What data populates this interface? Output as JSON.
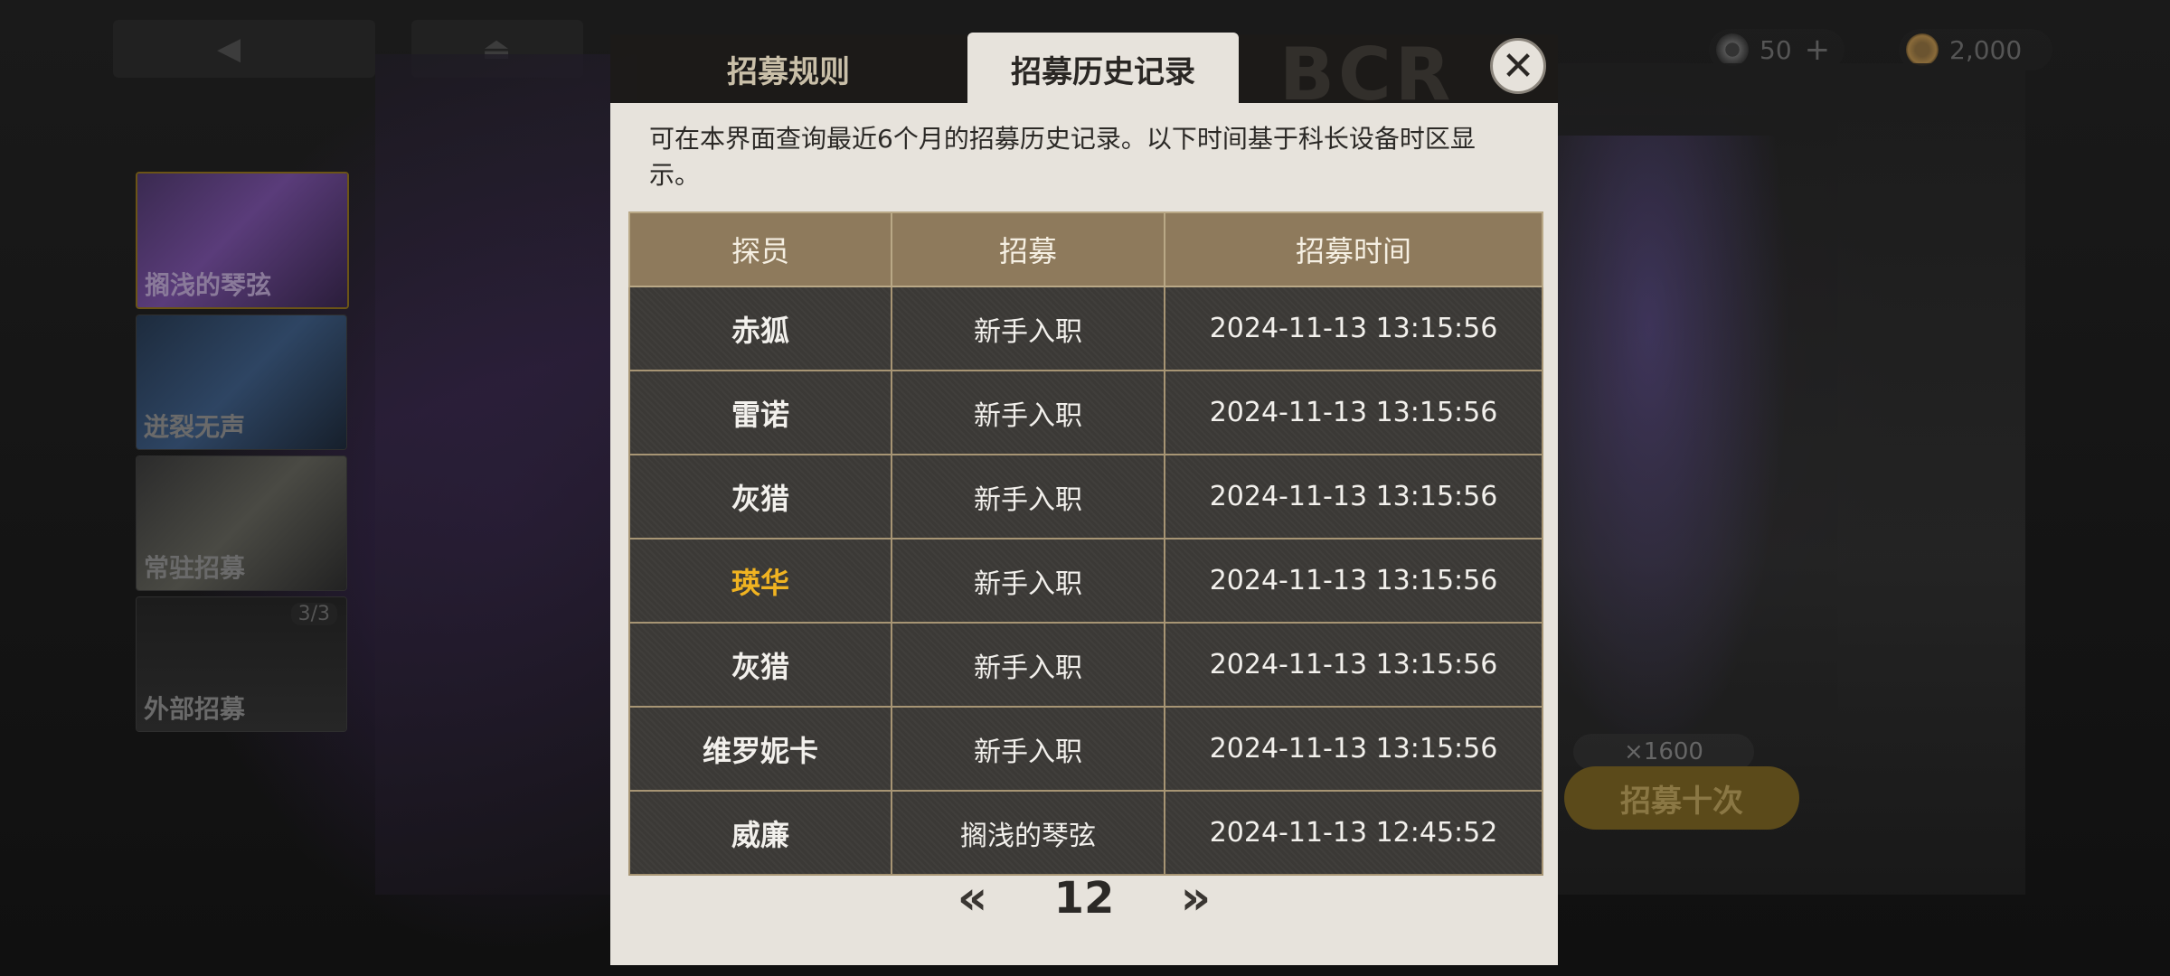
{
  "top_bar": {
    "back_glyph": "◀",
    "home_glyph": "⏏",
    "currency_1": {
      "icon": "disc-icon",
      "value": "50",
      "plus": "+"
    },
    "currency_2": {
      "icon": "gold-coin-icon",
      "value": "2,000"
    }
  },
  "left_tabs": [
    {
      "label": "搁浅的琴弦",
      "active": true,
      "badge": ""
    },
    {
      "label": "迸裂无声",
      "active": false,
      "badge": ""
    },
    {
      "label": "常驻招募",
      "active": false,
      "badge": ""
    },
    {
      "label": "外部招募",
      "active": false,
      "badge": "3/3"
    }
  ],
  "banner": {
    "recruit_ten_label": "招募十次",
    "cost": "×1600"
  },
  "modal": {
    "tabs": [
      {
        "label": "招募规则",
        "active": false
      },
      {
        "label": "招募历史记录",
        "active": true
      }
    ],
    "watermark": "BCR",
    "close_glyph": "✕",
    "description": "可在本界面查询最近6个月的招募历史记录。以下时间基于科长设备时区显示。",
    "table": {
      "headers": [
        "探员",
        "招募",
        "招募时间"
      ],
      "rows": [
        {
          "agent": "赤狐",
          "pool": "新手入职",
          "time": "2024-11-13 13:15:56",
          "highlight": false
        },
        {
          "agent": "雷诺",
          "pool": "新手入职",
          "time": "2024-11-13 13:15:56",
          "highlight": false
        },
        {
          "agent": "灰猎",
          "pool": "新手入职",
          "time": "2024-11-13 13:15:56",
          "highlight": false
        },
        {
          "agent": "瑛华",
          "pool": "新手入职",
          "time": "2024-11-13 13:15:56",
          "highlight": true
        },
        {
          "agent": "灰猎",
          "pool": "新手入职",
          "time": "2024-11-13 13:15:56",
          "highlight": false
        },
        {
          "agent": "维罗妮卡",
          "pool": "新手入职",
          "time": "2024-11-13 13:15:56",
          "highlight": false
        },
        {
          "agent": "威廉",
          "pool": "搁浅的琴弦",
          "time": "2024-11-13 12:45:52",
          "highlight": false
        }
      ]
    },
    "pager": {
      "prev_glyph": "«",
      "page": "12",
      "next_glyph": "»"
    }
  },
  "colors": {
    "header_bg": "#8e7a5c",
    "row_bg": "#3b3936",
    "highlight_text": "#f0b321",
    "panel_bg": "#e7e3dc"
  }
}
